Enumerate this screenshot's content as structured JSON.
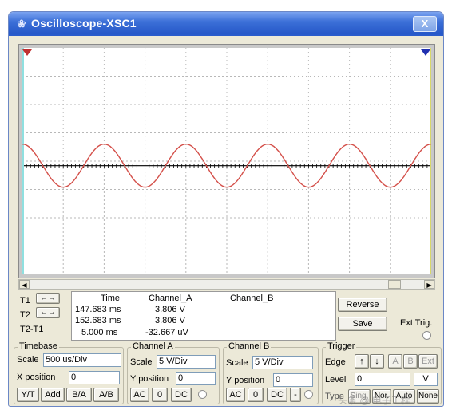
{
  "window": {
    "title": "Oscilloscope-XSC1",
    "icon": "oscilloscope-icon",
    "close_label": "X"
  },
  "readout": {
    "headers": [
      "Time",
      "Channel_A",
      "Channel_B"
    ],
    "rows": [
      {
        "label": "T1",
        "time": "147.683 ms",
        "channel_a": "3.806  V",
        "channel_b": ""
      },
      {
        "label": "T2",
        "time": "152.683 ms",
        "channel_a": "3.806  V",
        "channel_b": ""
      },
      {
        "label": "T2-T1",
        "time": "5.000 ms",
        "channel_a": "-32.667 uV",
        "channel_b": ""
      }
    ]
  },
  "buttons": {
    "reverse": "Reverse",
    "save": "Save",
    "ext_trig": "Ext Trig."
  },
  "timebase": {
    "title": "Timebase",
    "scale_label": "Scale",
    "scale_value": "500 us/Div",
    "xpos_label": "X position",
    "xpos_value": "0",
    "modes": [
      "Y/T",
      "Add",
      "B/A",
      "A/B"
    ]
  },
  "channel_a": {
    "title": "Channel A",
    "scale_label": "Scale",
    "scale_value": "5  V/Div",
    "ypos_label": "Y position",
    "ypos_value": "0",
    "coupling": [
      "AC",
      "0",
      "DC"
    ]
  },
  "channel_b": {
    "title": "Channel B",
    "scale_label": "Scale",
    "scale_value": "5  V/Div",
    "ypos_label": "Y position",
    "ypos_value": "0",
    "coupling": [
      "AC",
      "0",
      "DC",
      "-"
    ]
  },
  "trigger": {
    "title": "Trigger",
    "edge_label": "Edge",
    "edge_buttons": [
      "↑",
      "↓",
      "A",
      "B",
      "Ext"
    ],
    "level_label": "Level",
    "level_value": "0",
    "level_unit": "V",
    "type_label": "Type",
    "type_buttons": [
      "Sing.",
      "Nor.",
      "Auto",
      "None"
    ]
  },
  "watermark": "头条 @ 电子工程",
  "colors": {
    "trace": "#d4504a",
    "grid": "#b8b8b8",
    "cursor1": "#c03030",
    "cursor2": "#2030b0"
  },
  "chart_data": {
    "type": "line",
    "title": "",
    "xlabel": "",
    "ylabel": "",
    "x_divisions": 10,
    "y_divisions": 8,
    "timebase_per_div": "500 us/Div",
    "volts_per_div": "5 V/Div",
    "series": [
      {
        "waveform": "sine",
        "period_ms": 1.0,
        "amplitude_v": 3.8,
        "offset_v": 0,
        "cycles_visible": 5,
        "start_phase": "falling-from-max"
      }
    ]
  }
}
